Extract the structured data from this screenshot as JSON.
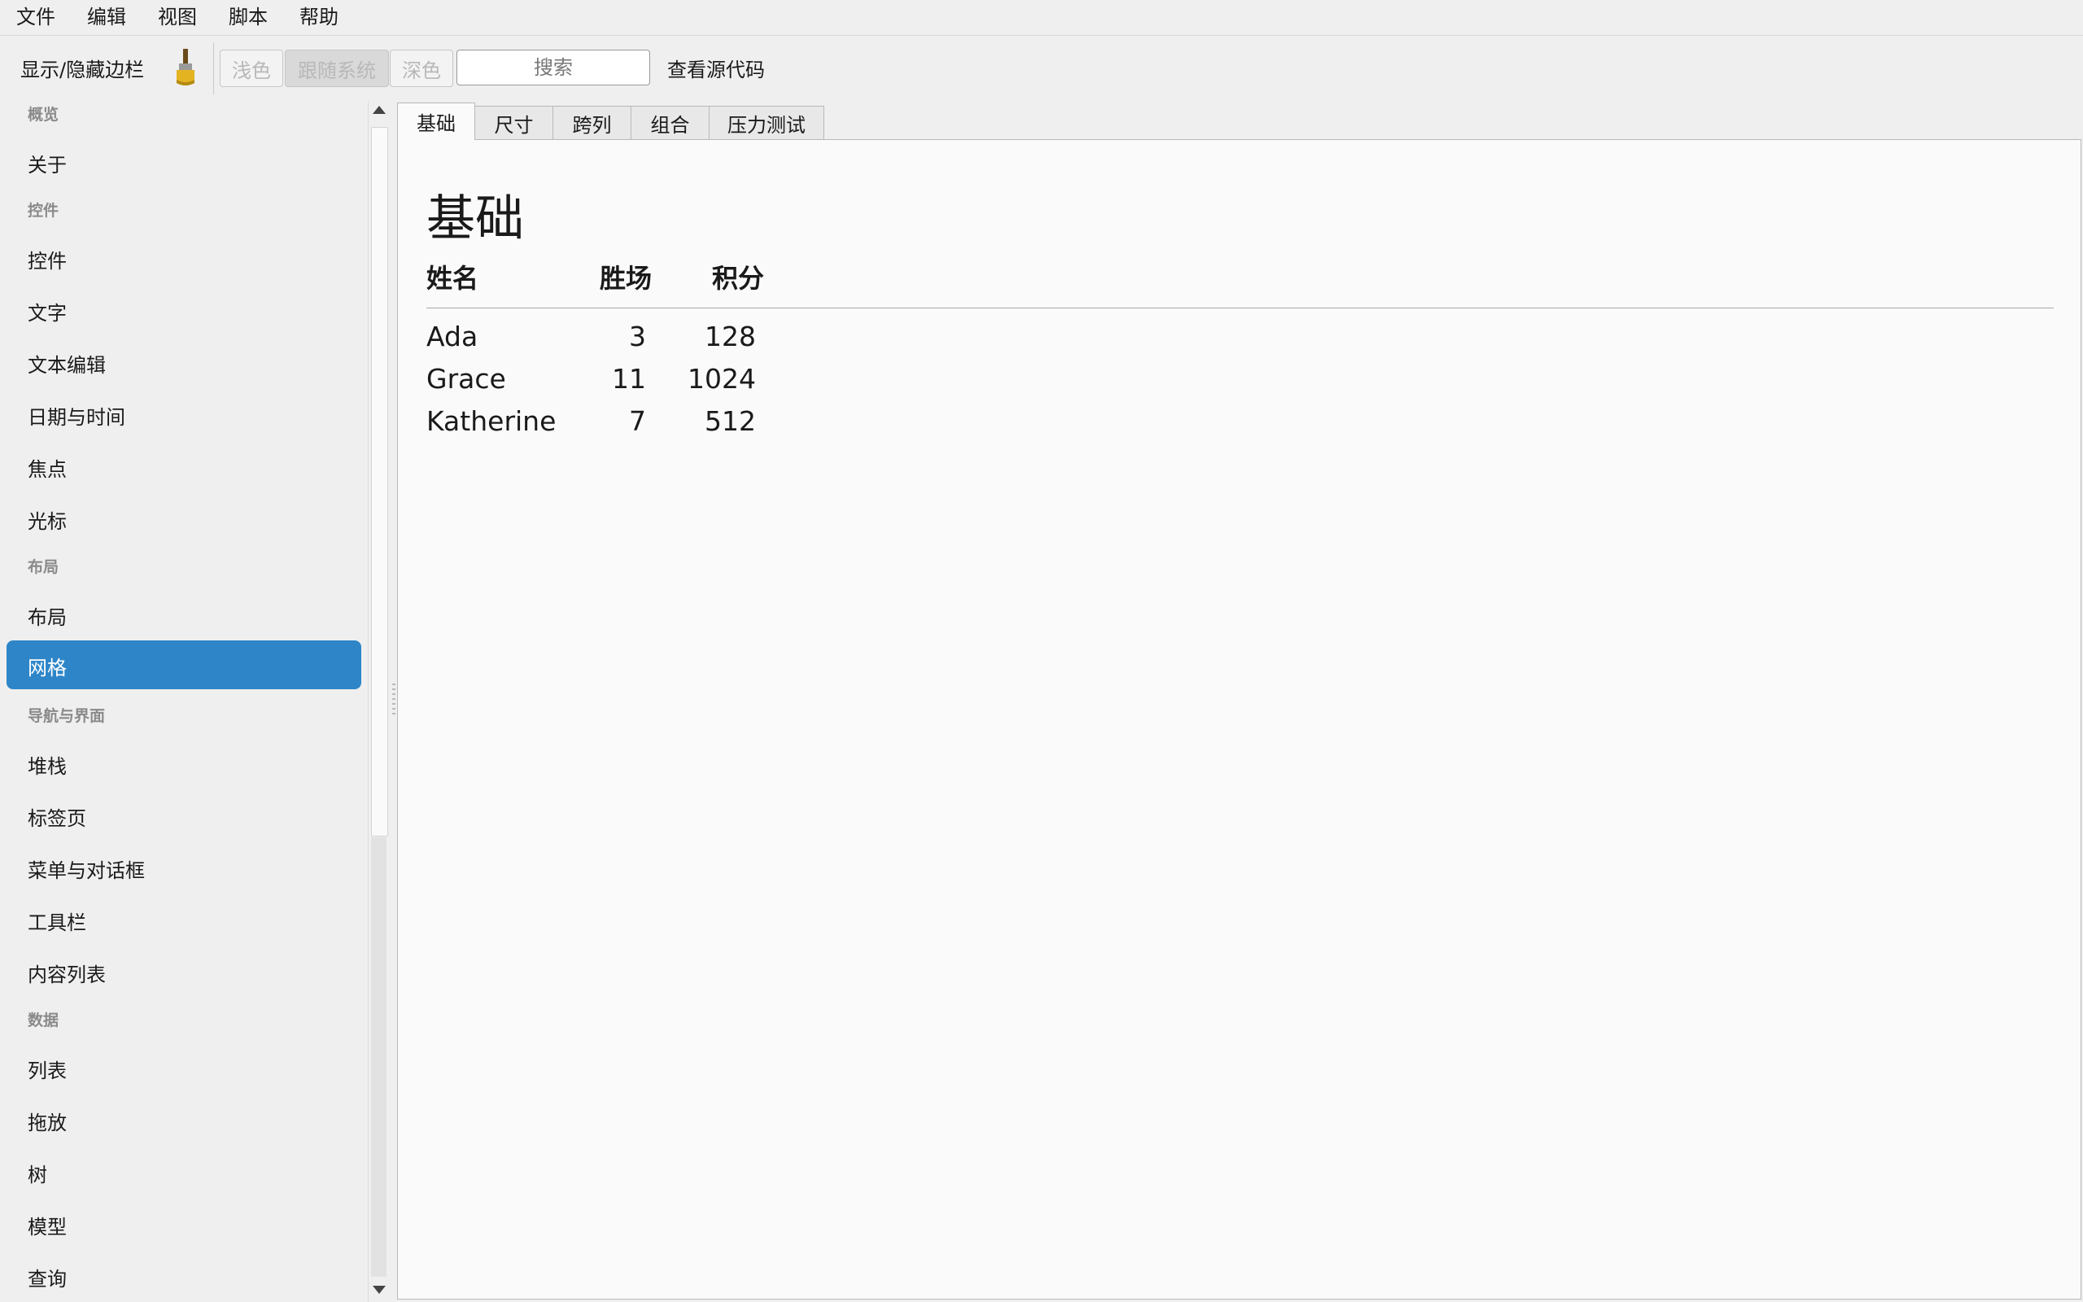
{
  "menubar": {
    "items": [
      "文件",
      "编辑",
      "视图",
      "脚本",
      "帮助"
    ]
  },
  "toolbar": {
    "toggle_sidebar": "显示/隐藏边栏",
    "theme_light": "浅色",
    "theme_system": "跟随系统",
    "theme_dark": "深色",
    "search_placeholder": "搜索",
    "view_source": "查看源代码"
  },
  "sidebar": {
    "cat_overview": "概览",
    "about": "关于",
    "cat_widgets": "控件",
    "widgets": "控件",
    "text": "文字",
    "text_edit": "文本编辑",
    "datetime": "日期与时间",
    "focus": "焦点",
    "cursor": "光标",
    "cat_layout": "布局",
    "layout": "布局",
    "grid": "网格",
    "cat_nav": "导航与界面",
    "stack": "堆栈",
    "tabs": "标签页",
    "menus": "菜单与对话框",
    "toolbar": "工具栏",
    "content_list": "内容列表",
    "cat_data": "数据",
    "list": "列表",
    "dnd": "拖放",
    "tree": "树",
    "model": "模型",
    "query": "查询"
  },
  "tabs": [
    "基础",
    "尺寸",
    "跨列",
    "组合",
    "压力测试"
  ],
  "panel": {
    "title": "基础",
    "headers": [
      "姓名",
      "胜场",
      "积分"
    ],
    "rows": [
      [
        "Ada",
        "3",
        "128"
      ],
      [
        "Grace",
        "11",
        "1024"
      ],
      [
        "Katherine",
        "7",
        "512"
      ]
    ]
  },
  "colors": {
    "selection": "#2e86c8",
    "disabled_text": "#b8b8b8"
  }
}
